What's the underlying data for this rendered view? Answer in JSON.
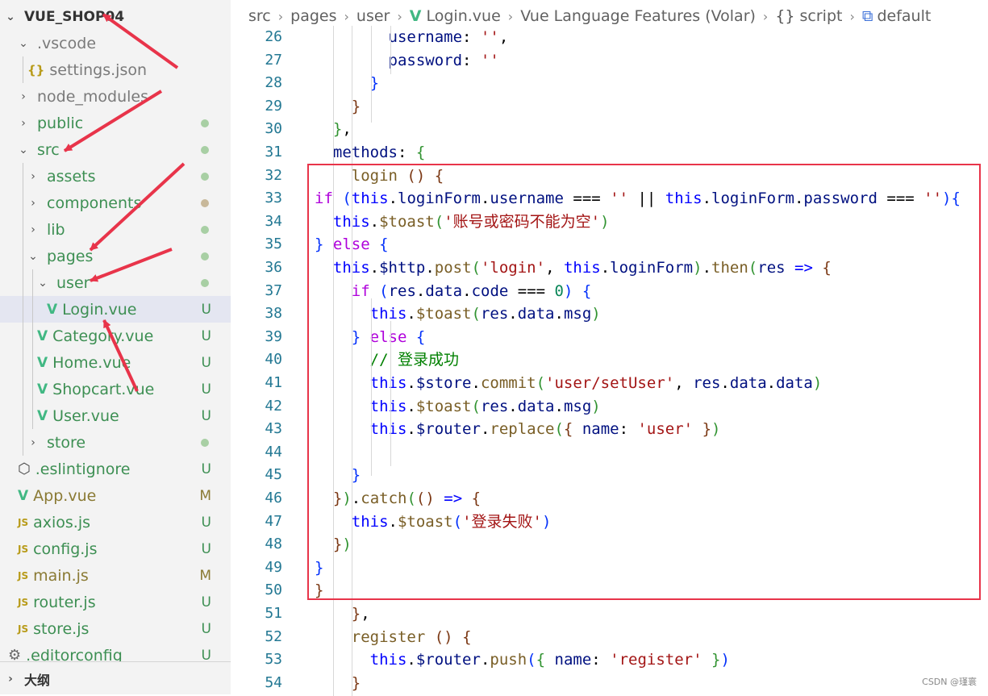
{
  "explorer": {
    "root_label": "VUE_SHOP04",
    "items": [
      {
        "label": ".vscode",
        "kind": "folder",
        "expanded": true,
        "status": ""
      },
      {
        "label": "settings.json",
        "kind": "json",
        "status": ""
      },
      {
        "label": "node_modules",
        "kind": "folder",
        "expanded": false,
        "status": ""
      },
      {
        "label": "public",
        "kind": "folder",
        "expanded": false,
        "status": "dot"
      },
      {
        "label": "src",
        "kind": "folder",
        "expanded": true,
        "status": "dot"
      },
      {
        "label": "assets",
        "kind": "folder",
        "expanded": false,
        "status": "dot"
      },
      {
        "label": "components",
        "kind": "folder",
        "expanded": false,
        "status": "dot-olive"
      },
      {
        "label": "lib",
        "kind": "folder",
        "expanded": false,
        "status": "dot"
      },
      {
        "label": "pages",
        "kind": "folder",
        "expanded": true,
        "status": "dot"
      },
      {
        "label": "user",
        "kind": "folder",
        "expanded": true,
        "status": "dot"
      },
      {
        "label": "Login.vue",
        "kind": "vue",
        "status": "U"
      },
      {
        "label": "Category.vue",
        "kind": "vue",
        "status": "U"
      },
      {
        "label": "Home.vue",
        "kind": "vue",
        "status": "U"
      },
      {
        "label": "Shopcart.vue",
        "kind": "vue",
        "status": "U"
      },
      {
        "label": "User.vue",
        "kind": "vue",
        "status": "U"
      },
      {
        "label": "store",
        "kind": "folder",
        "expanded": false,
        "status": "dot"
      },
      {
        "label": ".eslintignore",
        "kind": "ignore",
        "status": "U"
      },
      {
        "label": "App.vue",
        "kind": "vue",
        "status": "M"
      },
      {
        "label": "axios.js",
        "kind": "js",
        "status": "U"
      },
      {
        "label": "config.js",
        "kind": "js",
        "status": "U"
      },
      {
        "label": "main.js",
        "kind": "js",
        "status": "M"
      },
      {
        "label": "router.js",
        "kind": "js",
        "status": "U"
      },
      {
        "label": "store.js",
        "kind": "js",
        "status": "U"
      },
      {
        "label": ".editorconfig",
        "kind": "gear",
        "status": "U"
      }
    ],
    "outline_label": "大纲"
  },
  "breadcrumb": [
    "src",
    "pages",
    "user",
    "Login.vue",
    "Vue Language Features (Volar)",
    "script",
    "default"
  ],
  "code": {
    "lines": [
      {
        "n": "26",
        "tokens": [
          [
            "        ",
            ""
          ],
          [
            "username",
            "vr"
          ],
          [
            ": ",
            "op"
          ],
          [
            "''",
            "st"
          ],
          [
            ",",
            "op"
          ]
        ]
      },
      {
        "n": "27",
        "tokens": [
          [
            "        ",
            ""
          ],
          [
            "password",
            "vr"
          ],
          [
            ": ",
            "op"
          ],
          [
            "''",
            "st"
          ]
        ]
      },
      {
        "n": "28",
        "tokens": [
          [
            "      ",
            ""
          ],
          [
            "}",
            "b1"
          ]
        ]
      },
      {
        "n": "29",
        "tokens": [
          [
            "    ",
            ""
          ],
          [
            "}",
            "b3"
          ]
        ]
      },
      {
        "n": "30",
        "tokens": [
          [
            "  ",
            ""
          ],
          [
            "}",
            "b2"
          ],
          [
            ",",
            "op"
          ]
        ]
      },
      {
        "n": "31",
        "tokens": [
          [
            "  ",
            ""
          ],
          [
            "methods",
            "vr"
          ],
          [
            ": ",
            "op"
          ],
          [
            "{",
            "b2"
          ]
        ]
      },
      {
        "n": "32",
        "tokens": [
          [
            "    ",
            ""
          ],
          [
            "login",
            "fn"
          ],
          [
            " ",
            ""
          ],
          [
            "()",
            "b3"
          ],
          [
            " ",
            ""
          ],
          [
            "{",
            "b3"
          ]
        ]
      },
      {
        "n": "33",
        "tokens": [
          [
            "if",
            "kw"
          ],
          [
            " ",
            ""
          ],
          [
            "(",
            "b1"
          ],
          [
            "this",
            "kwb"
          ],
          [
            ".",
            "op"
          ],
          [
            "loginForm",
            "vr"
          ],
          [
            ".",
            "op"
          ],
          [
            "username",
            "vr"
          ],
          [
            " === ",
            "op"
          ],
          [
            "''",
            "st"
          ],
          [
            " || ",
            "op"
          ],
          [
            "this",
            "kwb"
          ],
          [
            ".",
            "op"
          ],
          [
            "loginForm",
            "vr"
          ],
          [
            ".",
            "op"
          ],
          [
            "password",
            "vr"
          ],
          [
            " === ",
            "op"
          ],
          [
            "''",
            "st"
          ],
          [
            ")",
            "b1"
          ],
          [
            "{",
            "b1"
          ]
        ]
      },
      {
        "n": "34",
        "tokens": [
          [
            "  ",
            ""
          ],
          [
            "this",
            "kwb"
          ],
          [
            ".",
            "op"
          ],
          [
            "$toast",
            "fn"
          ],
          [
            "(",
            "b2"
          ],
          [
            "'账号或密码不能为空'",
            "st"
          ],
          [
            ")",
            "b2"
          ]
        ]
      },
      {
        "n": "35",
        "tokens": [
          [
            "}",
            "b1"
          ],
          [
            " ",
            ""
          ],
          [
            "else",
            "kw"
          ],
          [
            " ",
            ""
          ],
          [
            "{",
            "b1"
          ]
        ]
      },
      {
        "n": "36",
        "tokens": [
          [
            "  ",
            ""
          ],
          [
            "this",
            "kwb"
          ],
          [
            ".",
            "op"
          ],
          [
            "$http",
            "vr"
          ],
          [
            ".",
            "op"
          ],
          [
            "post",
            "fn"
          ],
          [
            "(",
            "b2"
          ],
          [
            "'login'",
            "st"
          ],
          [
            ", ",
            "op"
          ],
          [
            "this",
            "kwb"
          ],
          [
            ".",
            "op"
          ],
          [
            "loginForm",
            "vr"
          ],
          [
            ")",
            "b2"
          ],
          [
            ".",
            "op"
          ],
          [
            "then",
            "fn"
          ],
          [
            "(",
            "b2"
          ],
          [
            "res",
            "vr"
          ],
          [
            " ",
            ""
          ],
          [
            "=>",
            "kwb"
          ],
          [
            " ",
            ""
          ],
          [
            "{",
            "b3"
          ]
        ]
      },
      {
        "n": "37",
        "tokens": [
          [
            "    ",
            ""
          ],
          [
            "if",
            "kw"
          ],
          [
            " ",
            ""
          ],
          [
            "(",
            "b1"
          ],
          [
            "res",
            "vr"
          ],
          [
            ".",
            "op"
          ],
          [
            "data",
            "vr"
          ],
          [
            ".",
            "op"
          ],
          [
            "code",
            "vr"
          ],
          [
            " === ",
            "op"
          ],
          [
            "0",
            "nu"
          ],
          [
            ")",
            "b1"
          ],
          [
            " ",
            ""
          ],
          [
            "{",
            "b1"
          ]
        ]
      },
      {
        "n": "38",
        "tokens": [
          [
            "      ",
            ""
          ],
          [
            "this",
            "kwb"
          ],
          [
            ".",
            "op"
          ],
          [
            "$toast",
            "fn"
          ],
          [
            "(",
            "b2"
          ],
          [
            "res",
            "vr"
          ],
          [
            ".",
            "op"
          ],
          [
            "data",
            "vr"
          ],
          [
            ".",
            "op"
          ],
          [
            "msg",
            "vr"
          ],
          [
            ")",
            "b2"
          ]
        ]
      },
      {
        "n": "39",
        "tokens": [
          [
            "    ",
            ""
          ],
          [
            "}",
            "b1"
          ],
          [
            " ",
            ""
          ],
          [
            "else",
            "kw"
          ],
          [
            " ",
            ""
          ],
          [
            "{",
            "b1"
          ]
        ]
      },
      {
        "n": "40",
        "tokens": [
          [
            "      ",
            ""
          ],
          [
            "// 登录成功",
            "cm"
          ]
        ]
      },
      {
        "n": "41",
        "tokens": [
          [
            "      ",
            ""
          ],
          [
            "this",
            "kwb"
          ],
          [
            ".",
            "op"
          ],
          [
            "$store",
            "vr"
          ],
          [
            ".",
            "op"
          ],
          [
            "commit",
            "fn"
          ],
          [
            "(",
            "b2"
          ],
          [
            "'user/setUser'",
            "st"
          ],
          [
            ", ",
            "op"
          ],
          [
            "res",
            "vr"
          ],
          [
            ".",
            "op"
          ],
          [
            "data",
            "vr"
          ],
          [
            ".",
            "op"
          ],
          [
            "data",
            "vr"
          ],
          [
            ")",
            "b2"
          ]
        ]
      },
      {
        "n": "42",
        "tokens": [
          [
            "      ",
            ""
          ],
          [
            "this",
            "kwb"
          ],
          [
            ".",
            "op"
          ],
          [
            "$toast",
            "fn"
          ],
          [
            "(",
            "b2"
          ],
          [
            "res",
            "vr"
          ],
          [
            ".",
            "op"
          ],
          [
            "data",
            "vr"
          ],
          [
            ".",
            "op"
          ],
          [
            "msg",
            "vr"
          ],
          [
            ")",
            "b2"
          ]
        ]
      },
      {
        "n": "43",
        "tokens": [
          [
            "      ",
            ""
          ],
          [
            "this",
            "kwb"
          ],
          [
            ".",
            "op"
          ],
          [
            "$router",
            "vr"
          ],
          [
            ".",
            "op"
          ],
          [
            "replace",
            "fn"
          ],
          [
            "(",
            "b2"
          ],
          [
            "{",
            "b3"
          ],
          [
            " ",
            ""
          ],
          [
            "name",
            "vr"
          ],
          [
            ": ",
            "op"
          ],
          [
            "'user'",
            "st"
          ],
          [
            " ",
            ""
          ],
          [
            "}",
            "b3"
          ],
          [
            ")",
            "b2"
          ]
        ]
      },
      {
        "n": "44",
        "tokens": []
      },
      {
        "n": "45",
        "tokens": [
          [
            "    ",
            ""
          ],
          [
            "}",
            "b1"
          ]
        ]
      },
      {
        "n": "46",
        "tokens": [
          [
            "  ",
            ""
          ],
          [
            "}",
            "b3"
          ],
          [
            ")",
            "b2"
          ],
          [
            ".",
            "op"
          ],
          [
            "catch",
            "fn"
          ],
          [
            "(",
            "b2"
          ],
          [
            "()",
            "b3"
          ],
          [
            " ",
            ""
          ],
          [
            "=>",
            "kwb"
          ],
          [
            " ",
            ""
          ],
          [
            "{",
            "b3"
          ]
        ]
      },
      {
        "n": "47",
        "tokens": [
          [
            "    ",
            ""
          ],
          [
            "this",
            "kwb"
          ],
          [
            ".",
            "op"
          ],
          [
            "$toast",
            "fn"
          ],
          [
            "(",
            "b1"
          ],
          [
            "'登录失败'",
            "st"
          ],
          [
            ")",
            "b1"
          ]
        ]
      },
      {
        "n": "48",
        "tokens": [
          [
            "  ",
            ""
          ],
          [
            "}",
            "b3"
          ],
          [
            ")",
            "b2"
          ]
        ]
      },
      {
        "n": "49",
        "tokens": [
          [
            "}",
            "b1"
          ]
        ]
      },
      {
        "n": "50",
        "tokens": [
          [
            "}",
            "b3"
          ]
        ]
      },
      {
        "n": "51",
        "tokens": [
          [
            "    ",
            ""
          ],
          [
            "}",
            "b3"
          ],
          [
            ",",
            "op"
          ]
        ]
      },
      {
        "n": "52",
        "tokens": [
          [
            "    ",
            ""
          ],
          [
            "register",
            "fn"
          ],
          [
            " ",
            ""
          ],
          [
            "()",
            "b3"
          ],
          [
            " ",
            ""
          ],
          [
            "{",
            "b3"
          ]
        ]
      },
      {
        "n": "53",
        "tokens": [
          [
            "      ",
            ""
          ],
          [
            "this",
            "kwb"
          ],
          [
            ".",
            "op"
          ],
          [
            "$router",
            "vr"
          ],
          [
            ".",
            "op"
          ],
          [
            "push",
            "fn"
          ],
          [
            "(",
            "b1"
          ],
          [
            "{",
            "b2"
          ],
          [
            " ",
            ""
          ],
          [
            "name",
            "vr"
          ],
          [
            ": ",
            "op"
          ],
          [
            "'register'",
            "st"
          ],
          [
            " ",
            ""
          ],
          [
            "}",
            "b2"
          ],
          [
            ")",
            "b1"
          ]
        ]
      },
      {
        "n": "54",
        "tokens": [
          [
            "    ",
            ""
          ],
          [
            "}",
            "b3"
          ]
        ]
      }
    ]
  },
  "watermark": "CSDN @瑾寰",
  "colors": {
    "highlight": "#e8344a",
    "arrows": "#e8344a",
    "vue_icon": "#41b883"
  }
}
